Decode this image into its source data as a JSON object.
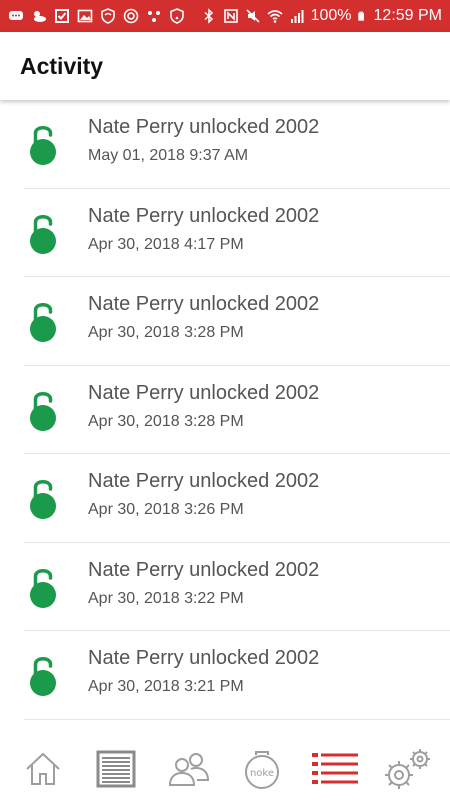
{
  "status_bar": {
    "battery": "100%",
    "time": "12:59 PM"
  },
  "app_bar": {
    "title": "Activity"
  },
  "activity": {
    "items": [
      {
        "title": "Nate Perry unlocked 2002",
        "time": "May 01, 2018  9:37 AM"
      },
      {
        "title": "Nate Perry unlocked 2002",
        "time": "Apr 30, 2018  4:17 PM"
      },
      {
        "title": "Nate Perry unlocked 2002",
        "time": "Apr 30, 2018  3:28 PM"
      },
      {
        "title": "Nate Perry unlocked 2002",
        "time": "Apr 30, 2018  3:28 PM"
      },
      {
        "title": "Nate Perry unlocked 2002",
        "time": "Apr 30, 2018  3:26 PM"
      },
      {
        "title": "Nate Perry unlocked 2002",
        "time": "Apr 30, 2018  3:22 PM"
      },
      {
        "title": "Nate Perry unlocked 2002",
        "time": "Apr 30, 2018  3:21 PM"
      }
    ]
  },
  "bottom_nav": {
    "items": [
      {
        "icon": "home-icon"
      },
      {
        "icon": "storage-unit-icon"
      },
      {
        "icon": "users-icon"
      },
      {
        "icon": "noke-lock-icon",
        "label": "noke"
      },
      {
        "icon": "activity-list-icon",
        "active": true
      },
      {
        "icon": "settings-icon"
      }
    ]
  },
  "colors": {
    "status_bar": "#d32f2f",
    "lock_green": "#1a9a4a",
    "active_nav": "#d32f2f",
    "inactive_nav": "#9e9e9e"
  }
}
